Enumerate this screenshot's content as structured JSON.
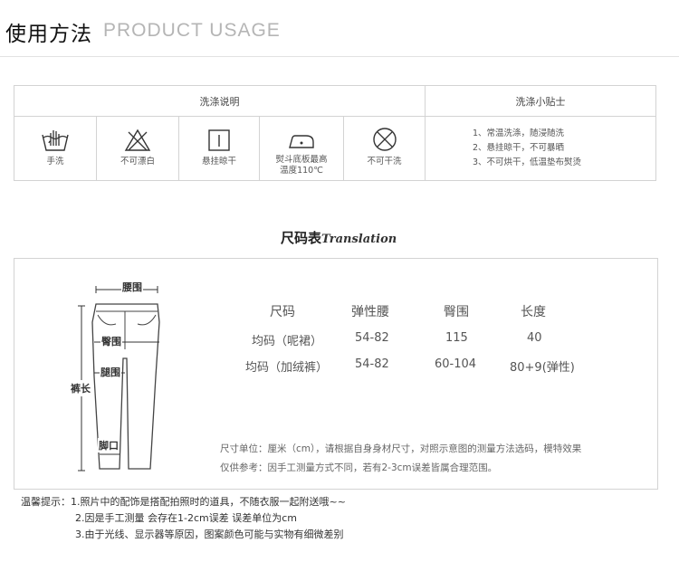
{
  "header": {
    "title": "使用方法",
    "subtitle": "PRODUCT USAGE"
  },
  "wash": {
    "left_header": "洗涤说明",
    "right_header": "洗涤小贴士",
    "icons": [
      {
        "icon": "hand-wash-icon",
        "label": "手洗"
      },
      {
        "icon": "no-bleach-icon",
        "label": "不可漂白"
      },
      {
        "icon": "hang-dry-icon",
        "label": "悬挂晾干"
      },
      {
        "icon": "iron-icon",
        "label": "熨斗底板最高",
        "label2": "温度110℃"
      },
      {
        "icon": "no-dry-clean-icon",
        "label": "不可干洗"
      }
    ],
    "tips": [
      "1、常温洗涤，随浸随洗",
      "2、悬挂晾干，不可暴晒",
      "3、不可烘干，低温垫布熨烫"
    ]
  },
  "size": {
    "title": "尺码表",
    "title_en": "Translation",
    "diagram_labels": {
      "waist": "腰围",
      "hip": "臀围",
      "thigh": "腿围",
      "length": "裤长",
      "hem": "脚口"
    },
    "columns": [
      "尺码",
      "弹性腰",
      "臀围",
      "长度"
    ],
    "rows": [
      [
        "均码（呢裙）",
        "54-82",
        "115",
        "40"
      ],
      [
        "均码（加绒裤）",
        "54-82",
        "60-104",
        "80+9(弹性)"
      ]
    ],
    "note1": "尺寸单位：厘米（cm），请根据自身身材尺寸，对照示意图的测量方法选码，模特效果",
    "note2": "仅供参考：因手工测量方式不同，若有2-3cm误差皆属合理范围。"
  },
  "reminder": {
    "line1": "温馨提示：1.照片中的配饰是搭配拍照时的道具，不随衣服一起附送哦~~",
    "line2": "2.因是手工测量 会存在1-2cm误差 误差单位为cm",
    "line3": "3.由于光线、显示器等原因，图案颜色可能与实物有细微差别"
  }
}
